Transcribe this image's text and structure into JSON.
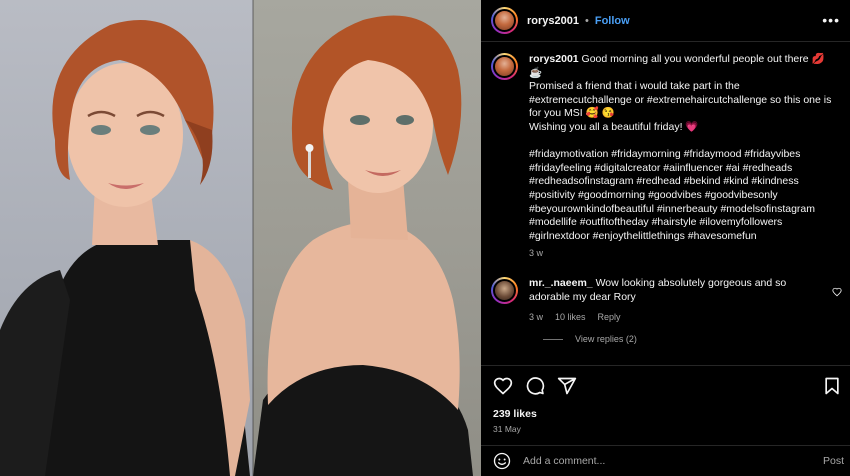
{
  "post": {
    "author": "rorys2001",
    "separator": "•",
    "follow_label": "Follow",
    "more_label": "•••",
    "caption": {
      "username": "rorys2001",
      "text": "Good morning all you wonderful people out there 💋 ☕\nPromised a friend that i would take part in the #extremecutchallenge or #extremehaircutchallenge so this one is for you MSI 🥰 😘\nWishing you all a beautiful friday! 💗\n\n#fridaymotivation #fridaymorning #fridaymood #fridayvibes #fridayfeeling #digitalcreator #aiinfluencer #ai #redheads #redheadsofinstagram #redhead #bekind #kind #kindness #positivity #goodmorning #goodvibes #goodvibesonly #beyourownkindofbeautiful #innerbeauty #modelsofinstagram #modellife #outfitoftheday #hairstyle #ilovemyfollowers #girlnextdoor #enjoythelittlethings #havesomefun",
      "time": "3 w"
    },
    "comments": [
      {
        "username": "mr._.naeem_",
        "text": "Wow looking absolutely gorgeous and so adorable my dear Rory",
        "time": "3 w",
        "likes": "10 likes",
        "reply_label": "Reply",
        "view_replies": "View replies (2)"
      }
    ],
    "likes": "239 likes",
    "date": "31 May",
    "add_comment": {
      "placeholder": "Add a comment...",
      "post_label": "Post"
    }
  },
  "icons": {
    "like": "heart-icon",
    "comment": "comment-bubble-icon",
    "share": "paper-plane-icon",
    "save": "bookmark-icon",
    "emoji": "smiley-icon",
    "more": "more-horizontal-icon"
  },
  "colors": {
    "background": "#000000",
    "link_blue": "#4a9ff5",
    "text_primary": "#f5f5f5",
    "text_secondary": "#a8a8a8",
    "divider": "#262626"
  }
}
